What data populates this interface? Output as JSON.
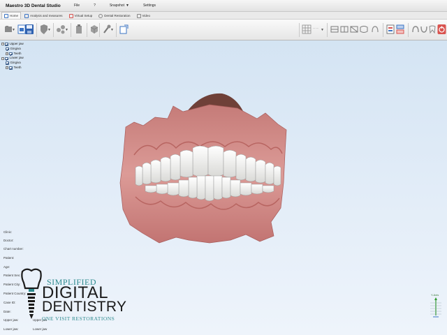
{
  "app": {
    "title": "Maestro 3D Dental Studio"
  },
  "menu": [
    {
      "label": "File"
    },
    {
      "label": "?"
    },
    {
      "label": "Snapshot"
    },
    {
      "label": "Settings"
    }
  ],
  "tabs": [
    {
      "label": "Home",
      "active": true
    },
    {
      "label": "Analysis and measures"
    },
    {
      "label": "Virtual Setup"
    },
    {
      "label": "Dental Restoration"
    },
    {
      "label": "Video"
    }
  ],
  "tree": [
    {
      "label": "Upper jaw",
      "level": 0
    },
    {
      "label": "Gingiva",
      "level": 1
    },
    {
      "label": "Teeth",
      "level": 1
    },
    {
      "label": "Lower jaw",
      "level": 0
    },
    {
      "label": "Gingiva",
      "level": 1
    },
    {
      "label": "Teeth",
      "level": 1
    }
  ],
  "patient_info": [
    {
      "label": "Clinic:",
      "value": ""
    },
    {
      "label": "Doctor:",
      "value": ""
    },
    {
      "label": "Chart number:",
      "value": ""
    },
    {
      "label": "Patient:",
      "value": ""
    },
    {
      "label": "Age:",
      "value": ""
    },
    {
      "label": "Patient Sex:",
      "value": ""
    },
    {
      "label": "Patient City:",
      "value": ""
    },
    {
      "label": "Patient Country:",
      "value": ""
    },
    {
      "label": "Case ID:",
      "value": ""
    },
    {
      "label": "Date:",
      "value": ""
    },
    {
      "label": "Upper jaw:",
      "value": "Upper jaw"
    },
    {
      "label": "Lower jaw:",
      "value": "Lower jaw"
    }
  ],
  "watermark": {
    "line1": "SIMPLIFIED",
    "line2": "DIGITAL",
    "line3": "DENTISTRY",
    "line4": "ONE VISIT RESTORATIONS"
  },
  "axis": {
    "label": "Y-Axis"
  },
  "colors": {
    "gingiva": "#d08a86",
    "teeth": "#f2f2f0",
    "viewport": "#dae7f5",
    "toolbar_accent": "#3b74c4",
    "danger": "#d9534f"
  }
}
